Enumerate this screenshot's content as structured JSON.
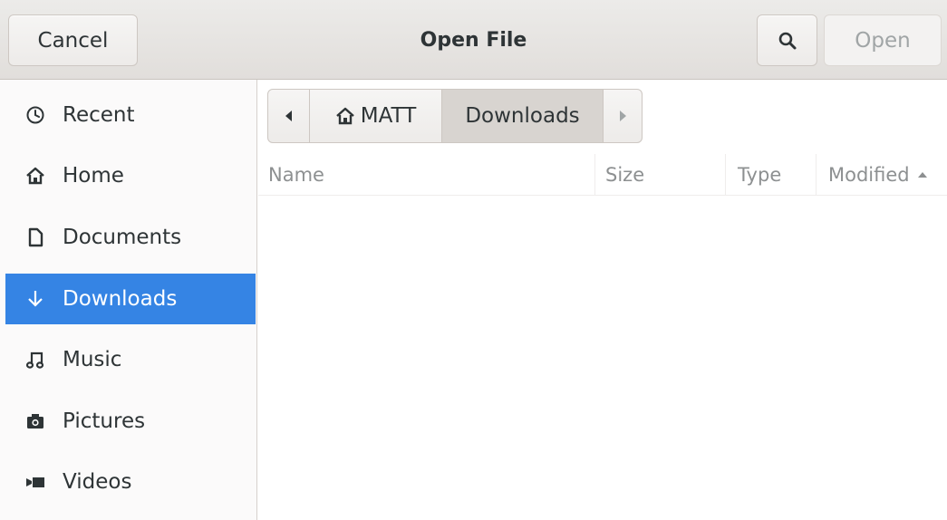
{
  "header": {
    "cancel_label": "Cancel",
    "title": "Open File",
    "open_label": "Open",
    "search_icon": "search-icon"
  },
  "sidebar": {
    "items": [
      {
        "label": "Recent",
        "icon": "clock-icon",
        "selected": false
      },
      {
        "label": "Home",
        "icon": "home-icon",
        "selected": false
      },
      {
        "label": "Documents",
        "icon": "document-icon",
        "selected": false
      },
      {
        "label": "Downloads",
        "icon": "download-icon",
        "selected": true
      },
      {
        "label": "Music",
        "icon": "music-icon",
        "selected": false
      },
      {
        "label": "Pictures",
        "icon": "camera-icon",
        "selected": false
      },
      {
        "label": "Videos",
        "icon": "video-icon",
        "selected": false
      }
    ]
  },
  "pathbar": {
    "home_label": "MATT",
    "current_label": "Downloads"
  },
  "columns": {
    "name": "Name",
    "size": "Size",
    "type": "Type",
    "modified": "Modified"
  },
  "colors": {
    "accent": "#3584e4",
    "headerbar": "#e1dedb",
    "text": "#2e3436",
    "dim_text": "#8d9091"
  }
}
